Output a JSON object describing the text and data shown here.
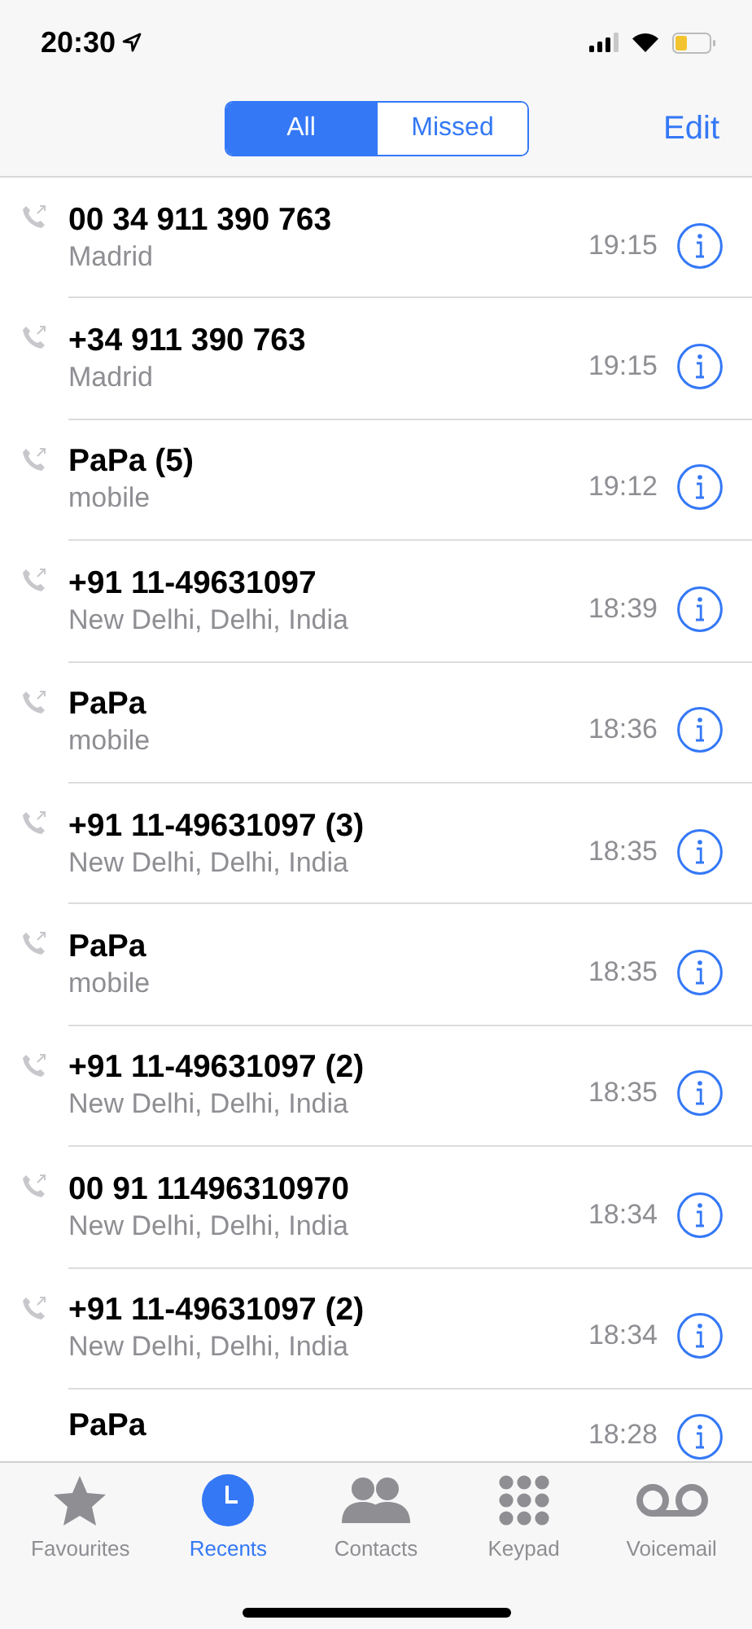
{
  "status_bar": {
    "time": "20:30"
  },
  "segments": [
    {
      "label": "All",
      "selected": true
    },
    {
      "label": "Missed",
      "selected": false
    }
  ],
  "edit": "Edit",
  "calls": [
    {
      "name": "00 34 911 390 763",
      "detail": "Madrid",
      "time": "19:15"
    },
    {
      "name": "+34 911 390 763",
      "detail": "Madrid",
      "time": "19:15"
    },
    {
      "name": "PaPa (5)",
      "detail": "mobile",
      "time": "19:12"
    },
    {
      "name": "+91 11-49631097",
      "detail": "New Delhi, Delhi, India",
      "time": "18:39"
    },
    {
      "name": "PaPa",
      "detail": "mobile",
      "time": "18:36"
    },
    {
      "name": "+91 11-49631097 (3)",
      "detail": "New Delhi, Delhi, India",
      "time": "18:35"
    },
    {
      "name": "PaPa",
      "detail": "mobile",
      "time": "18:35"
    },
    {
      "name": "+91 11-49631097 (2)",
      "detail": "New Delhi, Delhi, India",
      "time": "18:35"
    },
    {
      "name": "00 91 11496310970",
      "detail": "New Delhi, Delhi, India",
      "time": "18:34"
    },
    {
      "name": "+91 11-49631097 (2)",
      "detail": "New Delhi, Delhi, India",
      "time": "18:34"
    },
    {
      "name": "PaPa",
      "time": "18:28"
    }
  ],
  "tabs": [
    {
      "label": "Favourites",
      "selected": false
    },
    {
      "label": "Recents",
      "selected": true
    },
    {
      "label": "Contacts",
      "selected": false
    },
    {
      "label": "Keypad",
      "selected": false
    },
    {
      "label": "Voicemail",
      "selected": false
    }
  ]
}
